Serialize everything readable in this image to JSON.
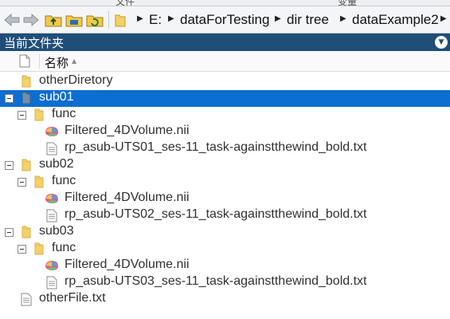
{
  "top_strip": {
    "left_label": "文件",
    "right_label": "变量"
  },
  "toolbar": {
    "back_label": "Back",
    "forward_label": "Forward",
    "up_label": "Up one level",
    "browse_label": "Browse for folder",
    "refresh_label": "Refresh"
  },
  "address": {
    "crumbs": [
      "E:",
      "dataForTesting",
      "dir tree",
      "dataExample2"
    ]
  },
  "panel": {
    "title": "当前文件夹",
    "column_name": "名称"
  },
  "tree": [
    {
      "label": "otherDiretory",
      "type": "folder",
      "level": 0,
      "expanded": false,
      "selected": false
    },
    {
      "label": "sub01",
      "type": "folder",
      "level": 0,
      "expanded": true,
      "selected": true
    },
    {
      "label": "func",
      "type": "folder",
      "level": 1,
      "expanded": true,
      "selected": false
    },
    {
      "label": "Filtered_4DVolume.nii",
      "type": "nifti",
      "level": 2,
      "selected": false
    },
    {
      "label": "rp_asub-UTS01_ses-11_task-againstthewind_bold.txt",
      "type": "text",
      "level": 2,
      "selected": false
    },
    {
      "label": "sub02",
      "type": "folder",
      "level": 0,
      "expanded": true,
      "selected": false
    },
    {
      "label": "func",
      "type": "folder",
      "level": 1,
      "expanded": true,
      "selected": false
    },
    {
      "label": "Filtered_4DVolume.nii",
      "type": "nifti",
      "level": 2,
      "selected": false
    },
    {
      "label": "rp_asub-UTS02_ses-11_task-againstthewind_bold.txt",
      "type": "text",
      "level": 2,
      "selected": false
    },
    {
      "label": "sub03",
      "type": "folder",
      "level": 0,
      "expanded": true,
      "selected": false
    },
    {
      "label": "func",
      "type": "folder",
      "level": 1,
      "expanded": true,
      "selected": false
    },
    {
      "label": "Filtered_4DVolume.nii",
      "type": "nifti",
      "level": 2,
      "selected": false
    },
    {
      "label": "rp_asub-UTS03_ses-11_task-againstthewind_bold.txt",
      "type": "text",
      "level": 2,
      "selected": false
    },
    {
      "label": "otherFile.txt",
      "type": "text",
      "level": 0,
      "selected": false
    }
  ],
  "colors": {
    "title_bar": "#1f4e79",
    "selection": "#0c6ed1",
    "folder": "#f5d06b"
  }
}
